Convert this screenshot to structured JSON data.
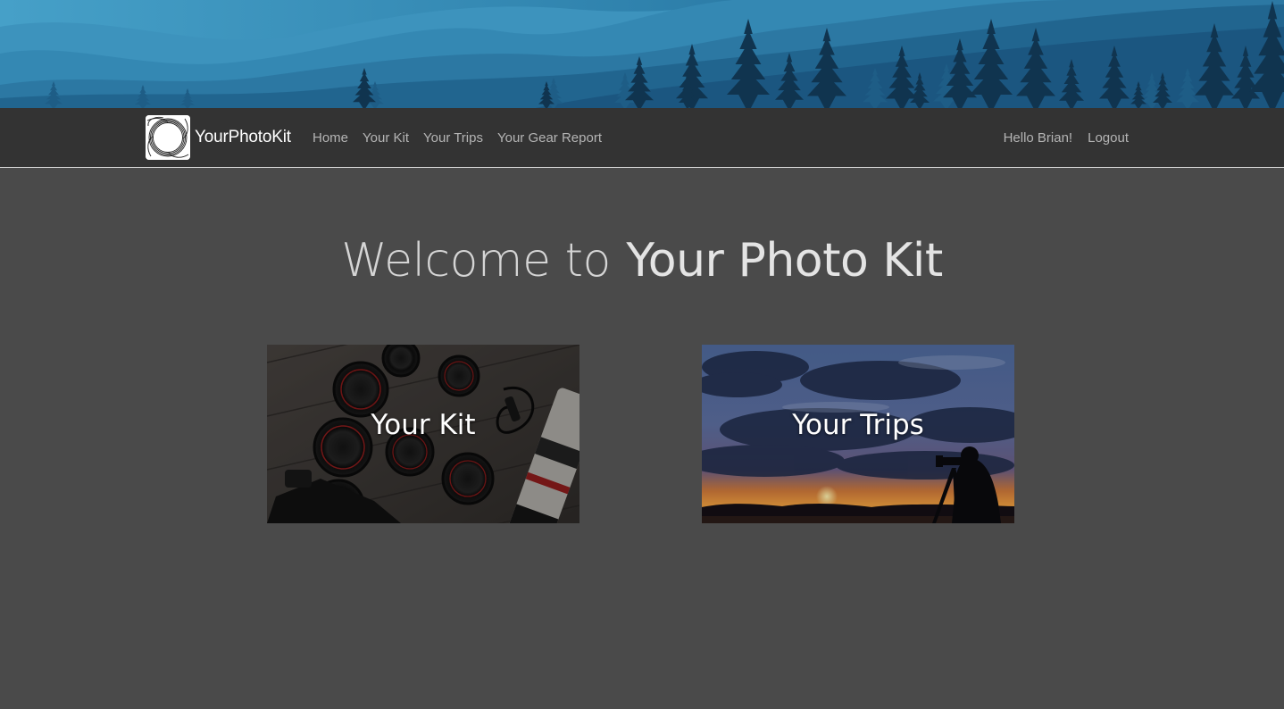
{
  "brand": {
    "name": "YourPhotoKit"
  },
  "nav": {
    "links": [
      {
        "label": "Home"
      },
      {
        "label": "Your Kit"
      },
      {
        "label": "Your Trips"
      },
      {
        "label": "Your Gear Report"
      }
    ],
    "greeting": "Hello Brian!",
    "logout": "Logout"
  },
  "main": {
    "welcome_prefix": "Welcome to",
    "welcome_emphasis": "Your Photo Kit",
    "cards": [
      {
        "label": "Your Kit"
      },
      {
        "label": "Your Trips"
      }
    ]
  },
  "colors": {
    "page_background": "#4a4a4a",
    "navbar_background": "#333333",
    "banner_sky": "#3a8fb8",
    "nav_link": "#b4b4b4"
  },
  "icons": {
    "logo": "spiral-aperture-logo-icon"
  }
}
